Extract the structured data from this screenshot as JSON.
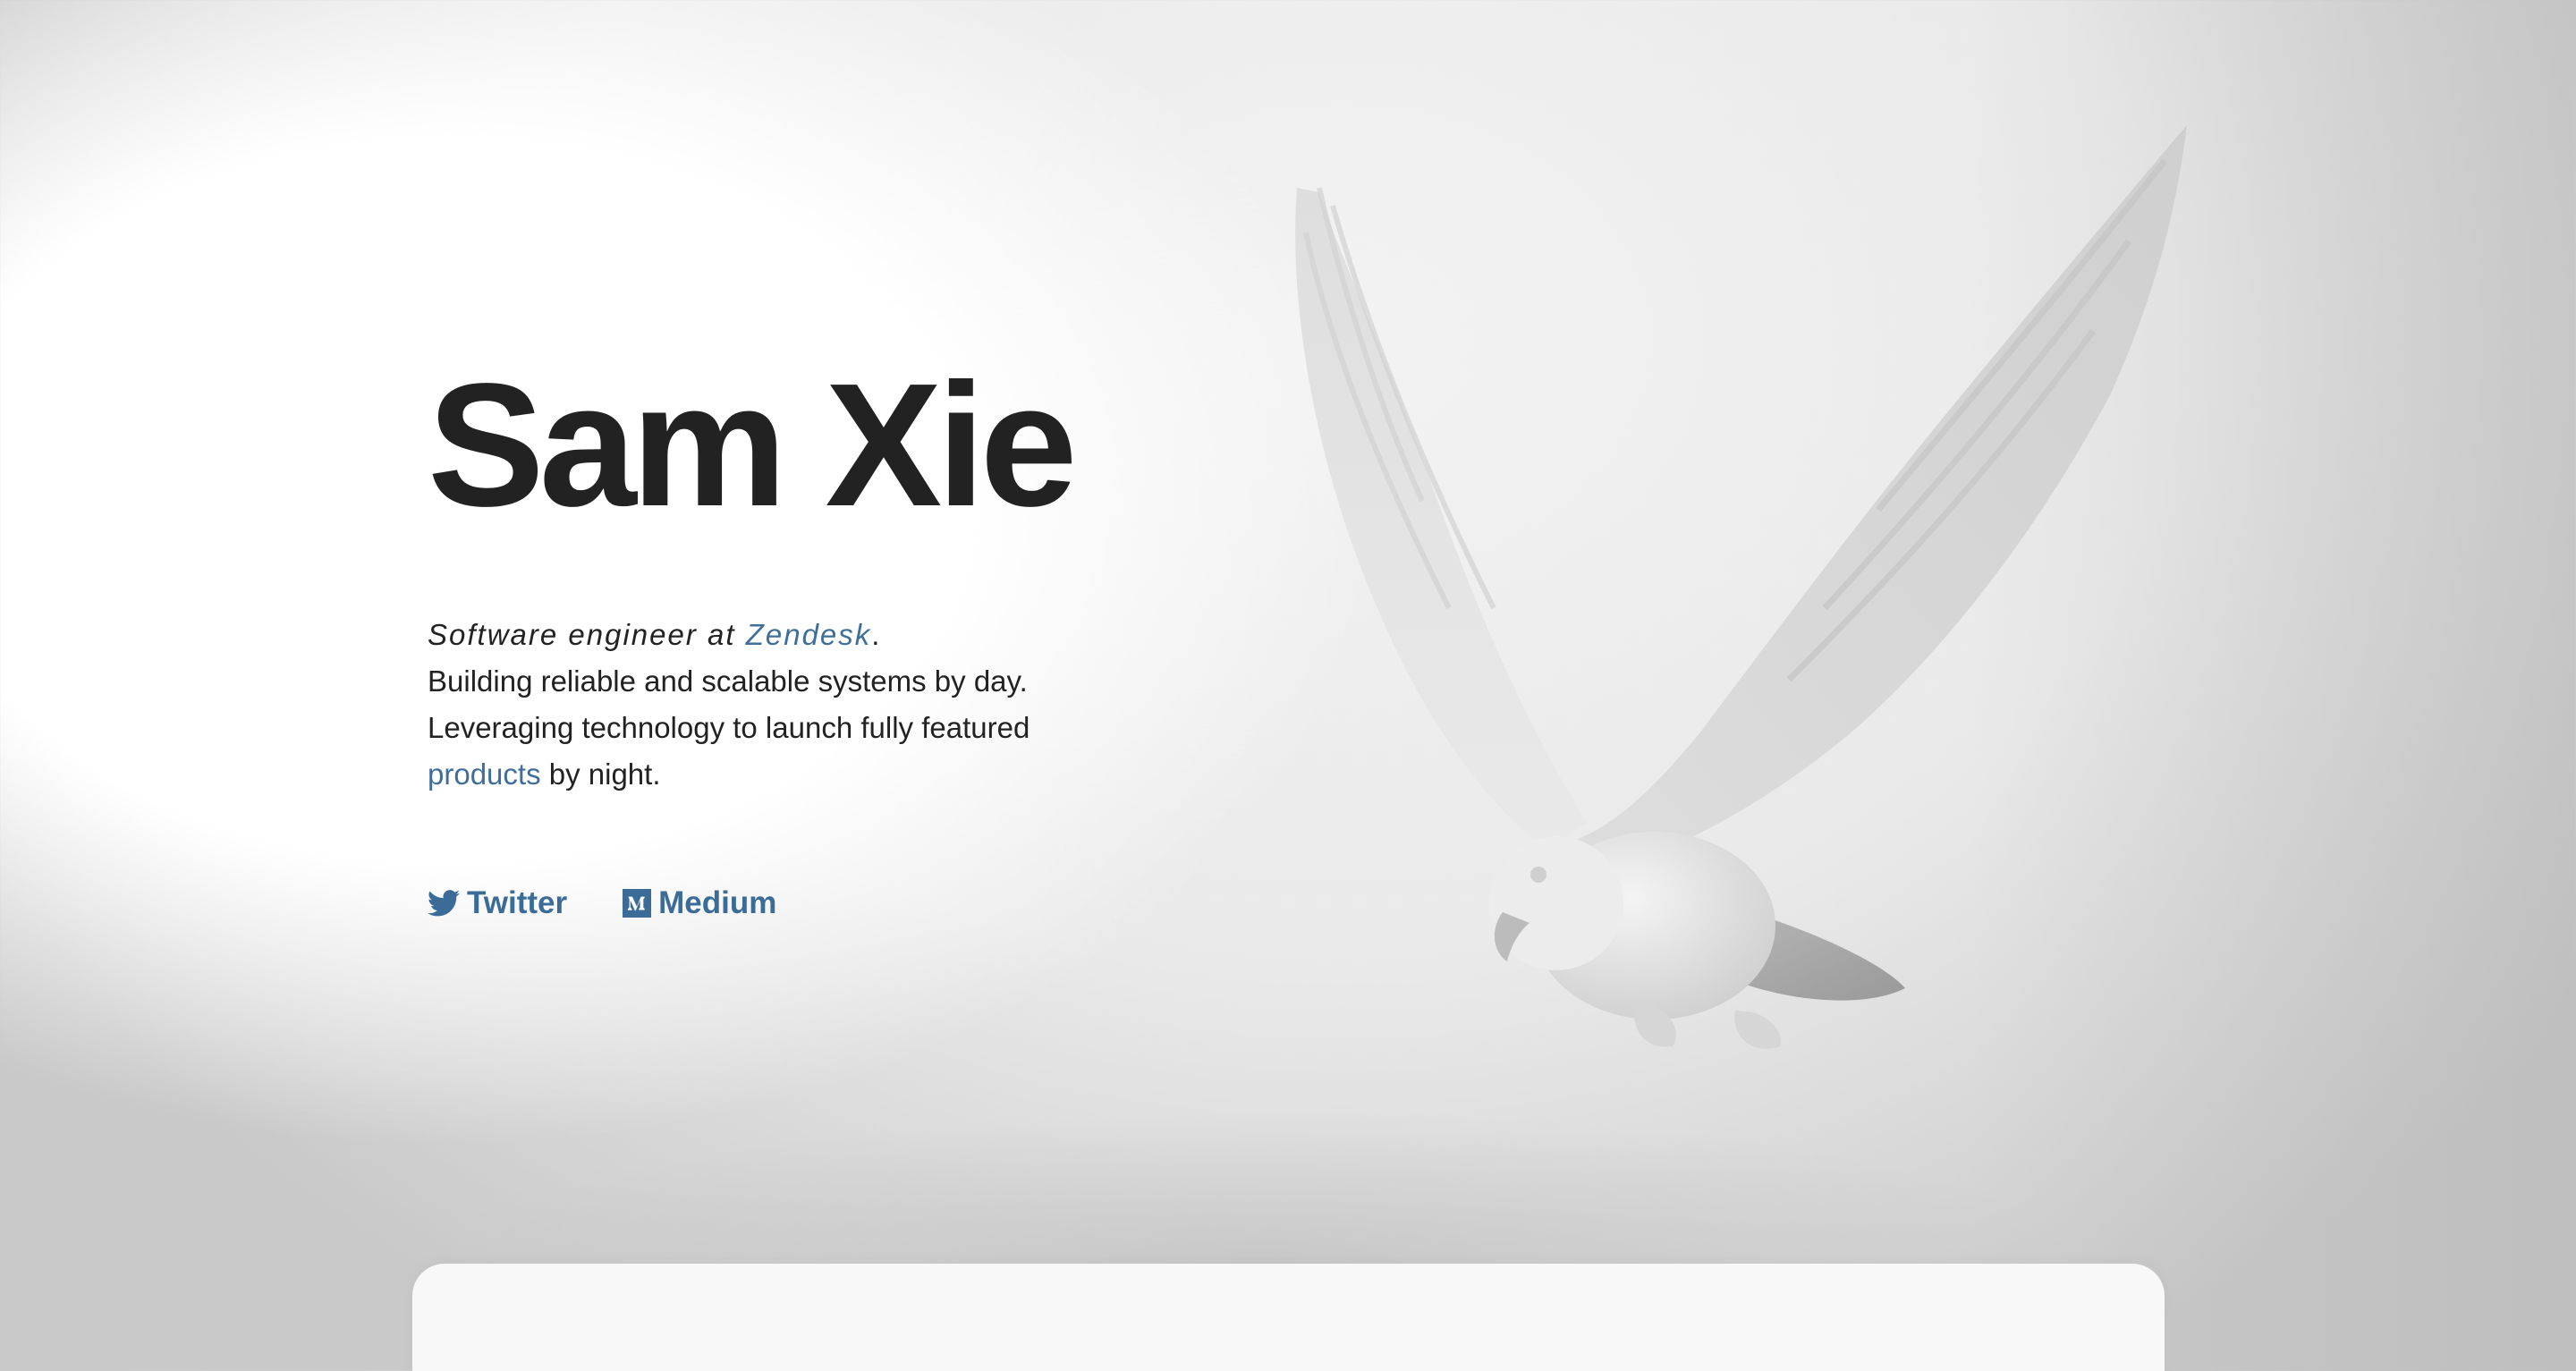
{
  "hero": {
    "name": "Sam Xie",
    "role_prefix": "Software engineer at ",
    "company": "Zendesk",
    "role_suffix": ".",
    "line2": "Building reliable and scalable systems by day.",
    "line3": "Leveraging technology to launch fully featured",
    "products_link": "products",
    "line4_suffix": " by night."
  },
  "social": {
    "twitter_label": "Twitter",
    "medium_label": "Medium"
  },
  "icons": {
    "twitter": "twitter-bird-icon",
    "medium": "medium-m-icon"
  },
  "colors": {
    "title": "#222222",
    "link": "#3f6f99",
    "background": "#ffffff"
  }
}
